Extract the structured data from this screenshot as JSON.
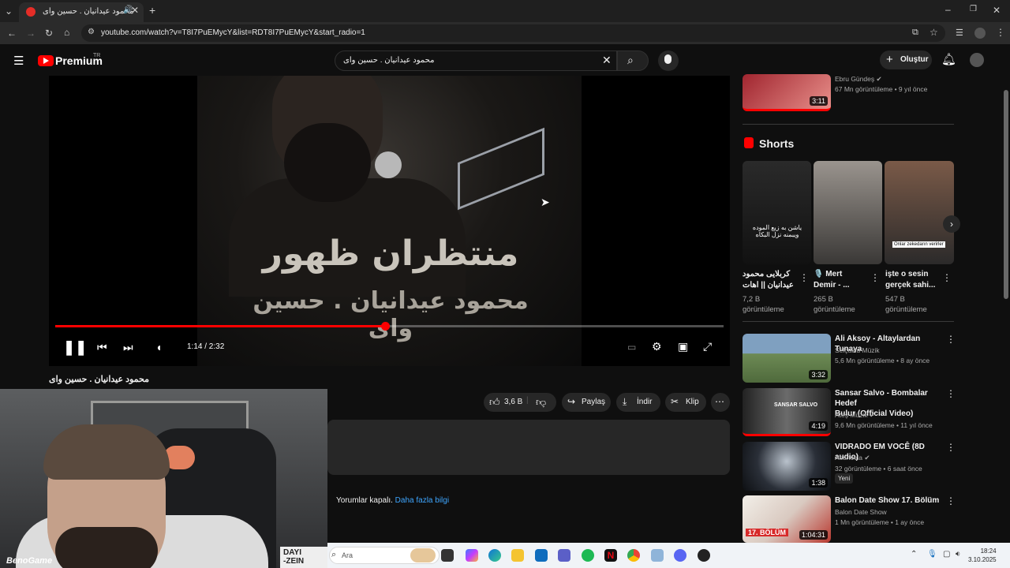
{
  "browser": {
    "tab_title": "محمود عیدانیان . حسین وای",
    "url": "youtube.com/watch?v=T8I7PuEMycY&list=RDT8I7PuEMycY&start_radio=1"
  },
  "header": {
    "logo_text": "Premium",
    "region": "TR",
    "search_query": "محمود عیدانیان . حسین وای",
    "create_label": "Oluştur"
  },
  "player": {
    "overlay_line1": "منتظران ظهور",
    "overlay_line2": "محمود عیدانیان . حسین وای",
    "time": "1:14 / 2:32",
    "progress": 0.493
  },
  "video": {
    "title": "محمود عیدانیان . حسین وای",
    "likes": "3,6 B",
    "share_label": "Paylaş",
    "download_label": "İndir",
    "clip_label": "Klip",
    "comments_off": "Yorumlar kapalı.",
    "learn_more": "Daha fazla bilgi"
  },
  "webcam": {
    "logo": "BenoGame",
    "sign_line1": "DAYI",
    "sign_line2": "-ZEIN"
  },
  "sidebar": {
    "top_item": {
      "channel": "Ebru Gündeş",
      "meta": "67 Mn görüntüleme • 9 yıl önce",
      "duration": "3:11"
    },
    "shorts_title": "Shorts",
    "shorts": [
      {
        "title_line1": "کربلایی محمود",
        "title_line2": "عیدانیان || اهات",
        "views_line1": "7,2 B",
        "views_line2": "görüntüleme",
        "overlay": "یاشن به زیع الموده ویبمنه نزل البکاه"
      },
      {
        "title_line1": "🎙️ Mert",
        "title_line2": "Demir - ...",
        "views_line1": "265 B",
        "views_line2": "görüntüleme",
        "overlay": ""
      },
      {
        "title_line1": "işte o sesin",
        "title_line2": "gerçek sahi...",
        "views_line1": "547 B",
        "views_line2": "görüntüleme",
        "overlay": "Onlar zekedarın verirler"
      }
    ],
    "items": [
      {
        "title_line1": "Ali Aksoy - Altaylardan Tunaya",
        "title_line2": "",
        "channel": "Selçuklu Müzik",
        "meta": "5,6 Mn görüntüleme • 8 ay önce",
        "duration": "3:32",
        "badge": "",
        "thumb_color": "#6d8a55"
      },
      {
        "title_line1": "Sansar Salvo - Bombalar Hedef",
        "title_line2": "Bulur (Official Video)",
        "channel": "Ateş Müzik",
        "meta": "9,6 Mn görüntüleme • 11 yıl önce",
        "duration": "4:19",
        "badge": "",
        "thumb_color": "#3b3b3b"
      },
      {
        "title_line1": "VIDRADO EM VOCÊ (8D audio)",
        "title_line2": "",
        "channel": "Aesnovia",
        "meta": "32 görüntüleme • 6 saat önce",
        "duration": "1:38",
        "badge": "Yeni",
        "thumb_color": "#2a2f38"
      },
      {
        "title_line1": "Balon Date Show 17. Bölüm",
        "title_line2": "",
        "channel": "Balon Date Show",
        "meta": "1 Mn görüntüleme • 1 ay önce",
        "duration": "1:04:31",
        "badge": "",
        "thumb_color": "#b8382f"
      }
    ],
    "thumb_overlay_text": "17. BÖLÜM",
    "thumb_overlay_text2": "SANSAR SALVO"
  },
  "taskbar": {
    "search_placeholder": "Ara",
    "time": "18:24",
    "date": "3.10.2025"
  },
  "colors": {
    "accent_red": "#ff0000",
    "link_blue": "#3ea6ff"
  }
}
